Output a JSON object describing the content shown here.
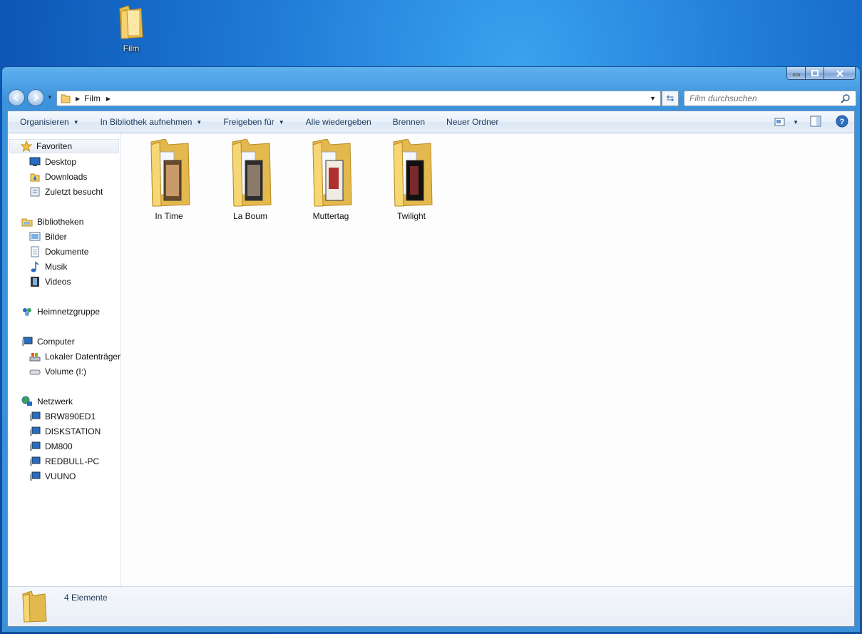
{
  "desktop": {
    "icon_label": "Film"
  },
  "window": {
    "breadcrumb": "Film",
    "search_placeholder": "Film durchsuchen"
  },
  "toolbar": {
    "organize": "Organisieren",
    "include_library": "In Bibliothek aufnehmen",
    "share_with": "Freigeben für",
    "play_all": "Alle wiedergeben",
    "burn": "Brennen",
    "new_folder": "Neuer Ordner"
  },
  "sidebar": {
    "favorites": "Favoriten",
    "desktop": "Desktop",
    "downloads": "Downloads",
    "recent": "Zuletzt besucht",
    "libraries": "Bibliotheken",
    "pictures": "Bilder",
    "documents": "Dokumente",
    "music": "Musik",
    "videos": "Videos",
    "homegroup": "Heimnetzgruppe",
    "computer": "Computer",
    "local_disk": "Lokaler Datenträger",
    "volume": "Volume (I:)",
    "network": "Netzwerk",
    "net_items": [
      "BRW890ED1",
      "DISKSTATION",
      "DM800",
      "REDBULL-PC",
      "VUUNO"
    ]
  },
  "folders": [
    "In Time",
    "La Boum",
    "Muttertag",
    "Twilight"
  ],
  "status": {
    "count": "4 Elemente"
  },
  "colors": {
    "accent": "#3d8fd6",
    "folder": "#f2cf6a"
  }
}
